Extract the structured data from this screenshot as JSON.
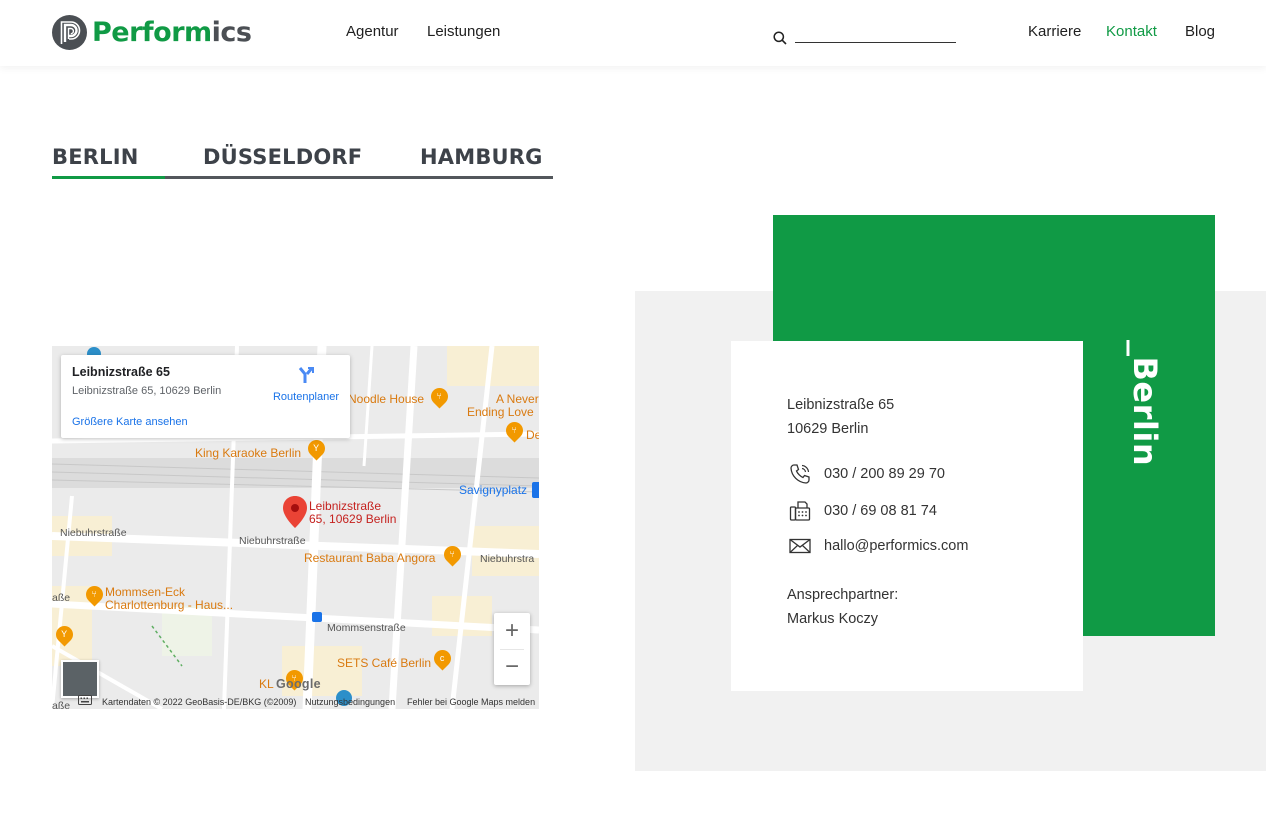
{
  "header": {
    "logo_text_green": "Perform",
    "logo_text_grey": "ics",
    "nav_left": [
      "Agentur",
      "Leistungen"
    ],
    "nav_right": [
      "Karriere",
      "Kontakt",
      "Blog"
    ],
    "active_nav": "Kontakt",
    "brand_color": "#109a45"
  },
  "tabs": [
    "BERLIN",
    "DÜSSELDORF",
    "HAMBURG"
  ],
  "active_tab": "BERLIN",
  "map": {
    "card_title": "Leibnizstraße 65",
    "card_address": "Leibnizstraße 65, 10629 Berlin",
    "card_link": "Größere Karte ansehen",
    "route_label": "Routenplaner",
    "pois": {
      "noodle": "Noodle House",
      "never1": "A Never",
      "never2": "Ending Love",
      "de": "De",
      "karaoke": "King Karaoke Berlin",
      "baba": "Restaurant Baba Angora",
      "mommsen1": "Mommsen-Eck",
      "mommsen2": "Charlottenburg - Haus...",
      "sets": "SETS Café Berlin",
      "kl": "KL"
    },
    "transit": "Savignyplatz",
    "marker_label1": "Leibnizstraße",
    "marker_label2": "65, 10629 Berlin",
    "streets": {
      "nieb1": "Niebuhrstraße",
      "nieb2": "Niebuhrstraße",
      "nieb3": "Niebuhrstra",
      "momms": "Mommsenstraße",
      "asse1": "aße",
      "asse2": "aße"
    },
    "google": "Google",
    "footer_data": "Kartendaten © 2022 GeoBasis-DE/BKG (©2009)",
    "footer_terms": "Nutzungsbedingungen",
    "footer_report": "Fehler bei Google Maps melden",
    "zoom_in": "+",
    "zoom_out": "−"
  },
  "contact": {
    "city_title": "_Berlin",
    "street": "Leibnizstraße 65",
    "zip_city": "10629 Berlin",
    "phone": "030 / 200 89 29 70",
    "fax": "030 / 69 08 81 74",
    "email": "hallo@performics.com",
    "partner_label": "Ansprechpartner:",
    "partner_name": "Markus Koczy"
  }
}
